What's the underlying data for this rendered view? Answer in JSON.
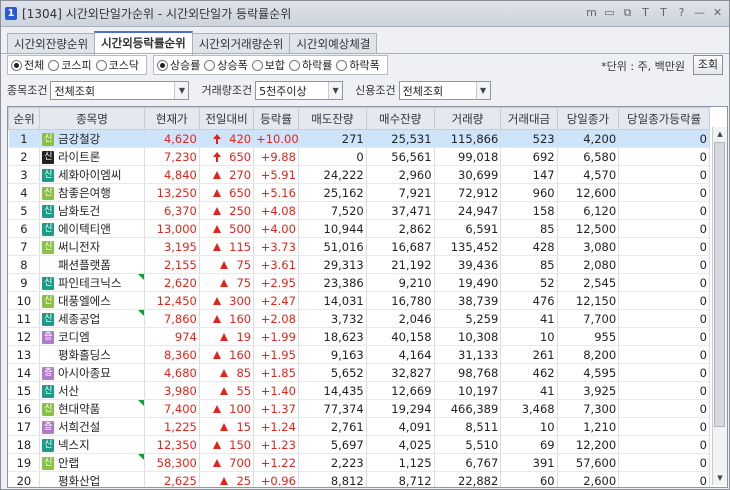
{
  "window": {
    "num": "1",
    "title": "[1304] 시간외단일가순위 - 시간외단일가 등락률순위"
  },
  "title_icons": [
    "m-icon",
    "doc-icon",
    "copy-icon",
    "pin-icon",
    "T",
    "?",
    "minimize-icon",
    "close-icon"
  ],
  "title_icon_glyphs": [
    "m",
    "▭",
    "⧉",
    "T",
    "T",
    "?",
    "—",
    "✕"
  ],
  "tabs": [
    "시간외잔량순위",
    "시간외등락률순위",
    "시간외거래량순위",
    "시간외예상체결"
  ],
  "market_radios": [
    "전체",
    "코스피",
    "코스닥"
  ],
  "sort_radios": [
    "상승률",
    "상승폭",
    "보합",
    "하락률",
    "하락폭"
  ],
  "unit_text": "*단위 : 주, 백만원",
  "query_button": "조회",
  "filters": {
    "item_label": "종목조건",
    "item_value": "전체조회",
    "volume_label": "거래량조건",
    "volume_value": "5천주이상",
    "credit_label": "신용조건",
    "credit_value": "전체조회"
  },
  "columns": [
    "순위",
    "종목명",
    "현재가",
    "전일대비",
    "등락률",
    "매도잔량",
    "매수잔량",
    "거래량",
    "거래대금",
    "당일종가",
    "당일종가등락률"
  ],
  "rows": [
    {
      "rank": "1",
      "badge": "신",
      "bc": "g",
      "name": "금강철강",
      "price": "4,620",
      "arrow": "upper",
      "chg": "420",
      "rate": "+10.00",
      "sell": "271",
      "buy": "25,531",
      "vol": "115,866",
      "amt": "523",
      "close": "4,200",
      "crate": "0",
      "sel": true
    },
    {
      "rank": "2",
      "badge": "신",
      "bc": "k",
      "name": "라이트론",
      "price": "7,230",
      "arrow": "upper",
      "chg": "650",
      "rate": "+9.88",
      "sell": "0",
      "buy": "56,561",
      "vol": "99,018",
      "amt": "692",
      "close": "6,580",
      "crate": "0"
    },
    {
      "rank": "3",
      "badge": "신",
      "bc": "t",
      "name": "세화아이엠씨",
      "price": "4,840",
      "arrow": "up",
      "chg": "270",
      "rate": "+5.91",
      "sell": "24,222",
      "buy": "2,960",
      "vol": "30,699",
      "amt": "147",
      "close": "4,570",
      "crate": "0"
    },
    {
      "rank": "4",
      "badge": "신",
      "bc": "g",
      "name": "참좋은여행",
      "price": "13,250",
      "arrow": "up",
      "chg": "650",
      "rate": "+5.16",
      "sell": "25,162",
      "buy": "7,921",
      "vol": "72,912",
      "amt": "960",
      "close": "12,600",
      "crate": "0"
    },
    {
      "rank": "5",
      "badge": "신",
      "bc": "t",
      "name": "남화토건",
      "price": "6,370",
      "arrow": "up",
      "chg": "250",
      "rate": "+4.08",
      "sell": "7,520",
      "buy": "37,471",
      "vol": "24,947",
      "amt": "158",
      "close": "6,120",
      "crate": "0"
    },
    {
      "rank": "6",
      "badge": "신",
      "bc": "t",
      "name": "에이텍티앤",
      "price": "13,000",
      "arrow": "up",
      "chg": "500",
      "rate": "+4.00",
      "sell": "10,944",
      "buy": "2,862",
      "vol": "6,591",
      "amt": "85",
      "close": "12,500",
      "crate": "0"
    },
    {
      "rank": "7",
      "badge": "신",
      "bc": "g",
      "name": "써니전자",
      "price": "3,195",
      "arrow": "up",
      "chg": "115",
      "rate": "+3.73",
      "sell": "51,016",
      "buy": "16,687",
      "vol": "135,452",
      "amt": "428",
      "close": "3,080",
      "crate": "0"
    },
    {
      "rank": "8",
      "badge": "",
      "bc": "",
      "name": "패션플랫폼",
      "price": "2,155",
      "arrow": "up",
      "chg": "75",
      "rate": "+3.61",
      "sell": "29,313",
      "buy": "21,192",
      "vol": "39,436",
      "amt": "85",
      "close": "2,080",
      "crate": "0"
    },
    {
      "rank": "9",
      "badge": "신",
      "bc": "t",
      "name": "파인테크닉스",
      "price": "2,620",
      "arrow": "up",
      "chg": "75",
      "rate": "+2.95",
      "sell": "23,386",
      "buy": "9,210",
      "vol": "19,490",
      "amt": "52",
      "close": "2,545",
      "crate": "0",
      "corner": true
    },
    {
      "rank": "10",
      "badge": "신",
      "bc": "g",
      "name": "대풍엘에스",
      "price": "12,450",
      "arrow": "up",
      "chg": "300",
      "rate": "+2.47",
      "sell": "14,031",
      "buy": "16,780",
      "vol": "38,739",
      "amt": "476",
      "close": "12,150",
      "crate": "0"
    },
    {
      "rank": "11",
      "badge": "신",
      "bc": "t",
      "name": "세종공업",
      "price": "7,860",
      "arrow": "up",
      "chg": "160",
      "rate": "+2.08",
      "sell": "3,732",
      "buy": "2,046",
      "vol": "5,259",
      "amt": "41",
      "close": "7,700",
      "crate": "0",
      "corner": true
    },
    {
      "rank": "12",
      "badge": "증",
      "bc": "p",
      "name": "코디엠",
      "price": "974",
      "arrow": "up",
      "chg": "19",
      "rate": "+1.99",
      "sell": "18,623",
      "buy": "40,158",
      "vol": "10,308",
      "amt": "10",
      "close": "955",
      "crate": "0"
    },
    {
      "rank": "13",
      "badge": "",
      "bc": "",
      "name": "평화홀딩스",
      "price": "8,360",
      "arrow": "up",
      "chg": "160",
      "rate": "+1.95",
      "sell": "9,163",
      "buy": "4,164",
      "vol": "31,133",
      "amt": "261",
      "close": "8,200",
      "crate": "0"
    },
    {
      "rank": "14",
      "badge": "증",
      "bc": "p",
      "name": "아시아종묘",
      "price": "4,680",
      "arrow": "up",
      "chg": "85",
      "rate": "+1.85",
      "sell": "5,652",
      "buy": "32,827",
      "vol": "98,768",
      "amt": "462",
      "close": "4,595",
      "crate": "0"
    },
    {
      "rank": "15",
      "badge": "신",
      "bc": "t",
      "name": "서산",
      "price": "3,980",
      "arrow": "up",
      "chg": "55",
      "rate": "+1.40",
      "sell": "14,435",
      "buy": "12,669",
      "vol": "10,197",
      "amt": "41",
      "close": "3,925",
      "crate": "0"
    },
    {
      "rank": "16",
      "badge": "신",
      "bc": "g",
      "name": "현대약품",
      "price": "7,400",
      "arrow": "up",
      "chg": "100",
      "rate": "+1.37",
      "sell": "77,374",
      "buy": "19,294",
      "vol": "466,389",
      "amt": "3,468",
      "close": "7,300",
      "crate": "0",
      "corner": true
    },
    {
      "rank": "17",
      "badge": "증",
      "bc": "p",
      "name": "서희건설",
      "price": "1,225",
      "arrow": "up",
      "chg": "15",
      "rate": "+1.24",
      "sell": "2,761",
      "buy": "4,091",
      "vol": "8,511",
      "amt": "10",
      "close": "1,210",
      "crate": "0"
    },
    {
      "rank": "18",
      "badge": "신",
      "bc": "t",
      "name": "넥스지",
      "price": "12,350",
      "arrow": "up",
      "chg": "150",
      "rate": "+1.23",
      "sell": "5,697",
      "buy": "4,025",
      "vol": "5,510",
      "amt": "69",
      "close": "12,200",
      "crate": "0"
    },
    {
      "rank": "19",
      "badge": "신",
      "bc": "g",
      "name": "안랩",
      "price": "58,300",
      "arrow": "up",
      "chg": "700",
      "rate": "+1.22",
      "sell": "2,223",
      "buy": "1,125",
      "vol": "6,767",
      "amt": "391",
      "close": "57,600",
      "crate": "0",
      "corner": true
    },
    {
      "rank": "20",
      "badge": "",
      "bc": "",
      "name": "평화산업",
      "price": "2,625",
      "arrow": "up",
      "chg": "25",
      "rate": "+0.96",
      "sell": "8,812",
      "buy": "8,712",
      "vol": "22,882",
      "amt": "60",
      "close": "2,600",
      "crate": "0"
    }
  ],
  "colors": {
    "up": "#e4231b",
    "selected_row": "#cde4fb",
    "badge_green": "#8bbf4a",
    "badge_teal": "#1e9b86",
    "badge_black": "#222222",
    "badge_purple": "#b07cc9"
  }
}
